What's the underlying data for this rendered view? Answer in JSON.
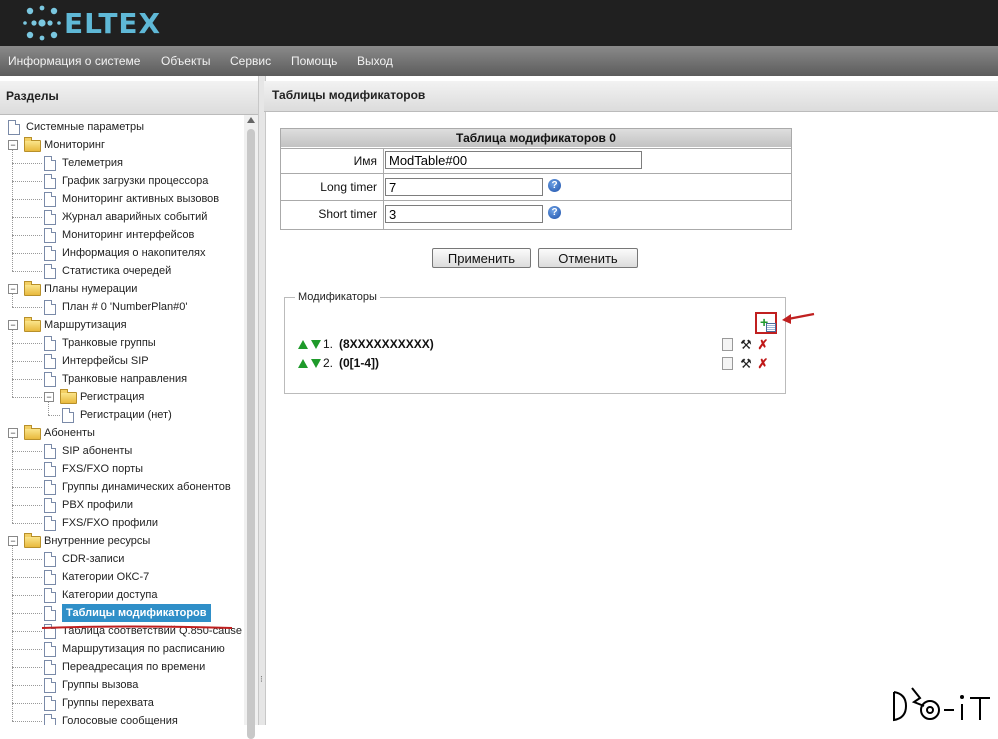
{
  "header": {
    "logo_text": "ELTEX",
    "logo_icon": "eltex-logo-icon"
  },
  "menu": [
    "Информация о системе",
    "Объекты",
    "Сервис",
    "Помощь",
    "Выход"
  ],
  "sidebar": {
    "title": "Разделы",
    "items": [
      {
        "label": "Системные параметры",
        "type": "page",
        "level": 0
      },
      {
        "label": "Мониторинг",
        "type": "folder",
        "level": 0
      },
      {
        "label": "Телеметрия",
        "type": "page",
        "level": 1
      },
      {
        "label": "График загрузки процессора",
        "type": "page",
        "level": 1
      },
      {
        "label": "Мониторинг активных вызовов",
        "type": "page",
        "level": 1
      },
      {
        "label": "Журнал аварийных событий",
        "type": "page",
        "level": 1
      },
      {
        "label": "Мониторинг интерфейсов",
        "type": "page",
        "level": 1
      },
      {
        "label": "Информация о накопителях",
        "type": "page",
        "level": 1
      },
      {
        "label": "Статистика очередей",
        "type": "page",
        "level": 1
      },
      {
        "label": "Планы нумерации",
        "type": "folder",
        "level": 0
      },
      {
        "label": "План # 0 'NumberPlan#0'",
        "type": "page",
        "level": 1
      },
      {
        "label": "Маршрутизация",
        "type": "folder",
        "level": 0
      },
      {
        "label": "Транковые группы",
        "type": "page",
        "level": 1
      },
      {
        "label": "Интерфейсы SIP",
        "type": "page",
        "level": 1
      },
      {
        "label": "Транковые направления",
        "type": "page",
        "level": 1
      },
      {
        "label": "Регистрация",
        "type": "folder",
        "level": 1
      },
      {
        "label": "Регистрации (нет)",
        "type": "page",
        "level": 2
      },
      {
        "label": "Абоненты",
        "type": "folder",
        "level": 0
      },
      {
        "label": "SIP абоненты",
        "type": "page",
        "level": 1
      },
      {
        "label": "FXS/FXO порты",
        "type": "page",
        "level": 1
      },
      {
        "label": "Группы динамических абонентов",
        "type": "page",
        "level": 1
      },
      {
        "label": "PBX профили",
        "type": "page",
        "level": 1
      },
      {
        "label": "FXS/FXO профили",
        "type": "page",
        "level": 1
      },
      {
        "label": "Внутренние ресурсы",
        "type": "folder",
        "level": 0
      },
      {
        "label": "CDR-записи",
        "type": "page",
        "level": 1
      },
      {
        "label": "Категории ОКС-7",
        "type": "page",
        "level": 1
      },
      {
        "label": "Категории доступа",
        "type": "page",
        "level": 1
      },
      {
        "label": "Таблицы модификаторов",
        "type": "page",
        "level": 1,
        "selected": true
      },
      {
        "label": "Таблица соответствий Q.850-cause",
        "type": "page",
        "level": 1
      },
      {
        "label": "Маршрутизация по расписанию",
        "type": "page",
        "level": 1
      },
      {
        "label": "Переадресация по времени",
        "type": "page",
        "level": 1
      },
      {
        "label": "Группы вызова",
        "type": "page",
        "level": 1
      },
      {
        "label": "Группы перехвата",
        "type": "page",
        "level": 1
      },
      {
        "label": "Голосовые сообщения",
        "type": "page",
        "level": 1
      }
    ]
  },
  "main": {
    "title": "Таблицы модификаторов",
    "table_title": "Таблица модификаторов 0",
    "fields": {
      "name": {
        "label": "Имя",
        "value": "ModTable#00"
      },
      "long_timer": {
        "label": "Long timer",
        "value": "7"
      },
      "short_timer": {
        "label": "Short timer",
        "value": "3"
      }
    },
    "help_icon": "?",
    "apply_label": "Применить",
    "cancel_label": "Отменить",
    "modifiers": {
      "legend": "Модификаторы",
      "rows": [
        {
          "num": "1.",
          "text": "(8XXXXXXXXXX)"
        },
        {
          "num": "2.",
          "text": "(0[1-4])"
        }
      ]
    }
  },
  "colors": {
    "header_bg": "#202020",
    "logo": "#5fb8d6",
    "selected_bg": "#2f8fc8",
    "annotation_red": "#c02020",
    "arrow_green": "#1e9a2a"
  }
}
